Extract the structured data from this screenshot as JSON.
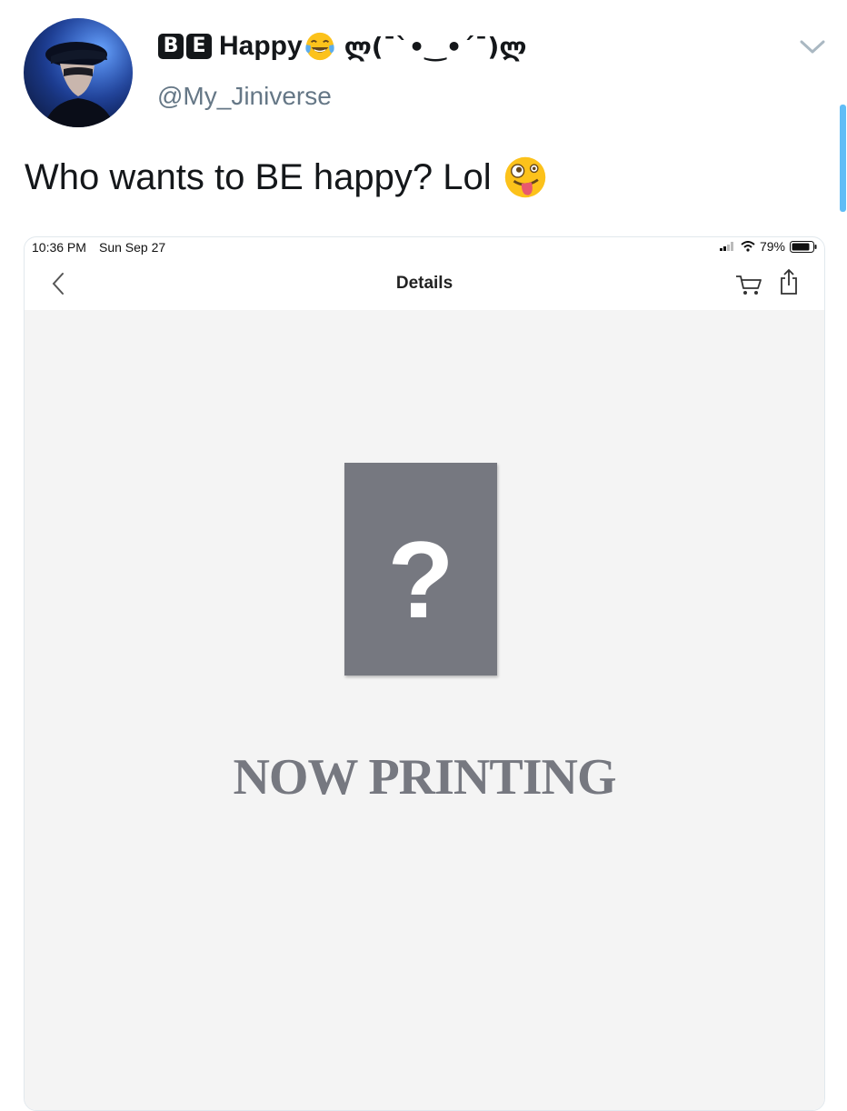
{
  "tweet": {
    "author": {
      "display_name_boxes": [
        "B",
        "E"
      ],
      "display_name_text": "Happy",
      "display_name_emoji": "face-with-tears-of-joy",
      "kaomoji": "ლ(¯`•‿•´¯)ლ",
      "handle": "@My_Jiniverse"
    },
    "menu_icon": "chevron-down-icon",
    "text": "Who wants to BE happy? Lol",
    "text_emoji": "zany-face",
    "accent_color": "#1da1f2"
  },
  "screenshot": {
    "status_bar": {
      "time": "10:36 PM",
      "date": "Sun Sep 27",
      "battery": "79%"
    },
    "nav": {
      "title": "Details",
      "icons": [
        "back-chevron-icon",
        "cart-icon",
        "share-icon"
      ]
    },
    "placeholder": {
      "symbol": "?",
      "caption": "NOW PRINTING",
      "color": "#767880"
    }
  }
}
